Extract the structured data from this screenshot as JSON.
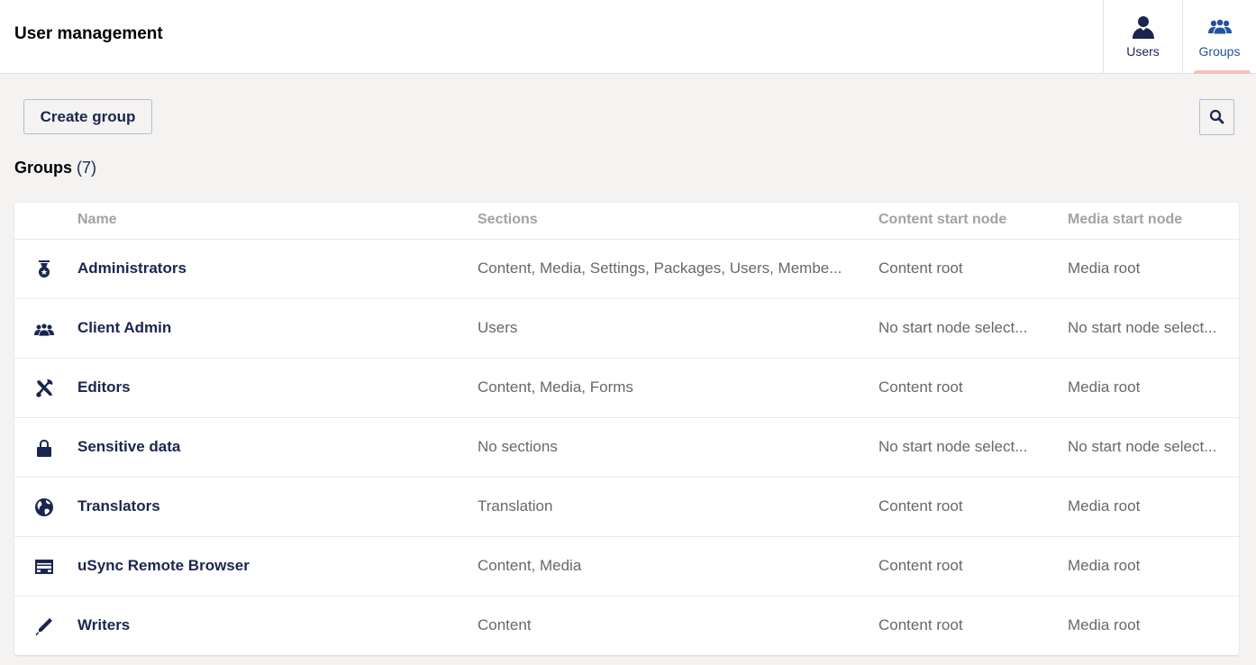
{
  "header": {
    "title": "User management",
    "tabs": [
      {
        "label": "Users",
        "icon": "user-icon",
        "active": false
      },
      {
        "label": "Groups",
        "icon": "users-group-icon",
        "active": true
      }
    ]
  },
  "toolbar": {
    "create_label": "Create group",
    "search_icon": "search-icon"
  },
  "groups": {
    "heading": "Groups",
    "count": "(7)"
  },
  "table": {
    "columns": [
      "Name",
      "Sections",
      "Content start node",
      "Media start node"
    ],
    "rows": [
      {
        "icon": "medal-icon",
        "name": "Administrators",
        "sections": "Content, Media, Settings, Packages, Users, Membe...",
        "content_start": "Content root",
        "media_start": "Media root"
      },
      {
        "icon": "users-group-icon",
        "name": "Client Admin",
        "sections": "Users",
        "content_start": "No start node select...",
        "media_start": "No start node select..."
      },
      {
        "icon": "tools-icon",
        "name": "Editors",
        "sections": "Content, Media, Forms",
        "content_start": "Content root",
        "media_start": "Media root"
      },
      {
        "icon": "lock-icon",
        "name": "Sensitive data",
        "sections": "No sections",
        "content_start": "No start node select...",
        "media_start": "No start node select..."
      },
      {
        "icon": "globe-icon",
        "name": "Translators",
        "sections": "Translation",
        "content_start": "Content root",
        "media_start": "Media root"
      },
      {
        "icon": "browser-window-icon",
        "name": "uSync Remote Browser",
        "sections": "Content, Media",
        "content_start": "Content root",
        "media_start": "Media root"
      },
      {
        "icon": "pencil-icon",
        "name": "Writers",
        "sections": "Content",
        "content_start": "Content root",
        "media_start": "Media root"
      }
    ]
  },
  "colors": {
    "primary_text": "#1b264f",
    "active_tab": "#2152a3",
    "tab_indicator": "#f5c1bc",
    "muted_text": "#68676b",
    "background": "#f4f3f2"
  }
}
